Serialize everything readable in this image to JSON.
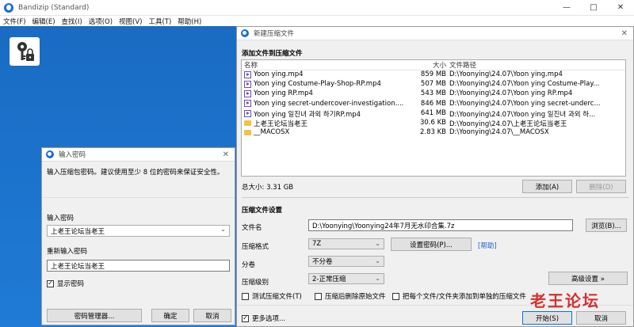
{
  "window": {
    "title": "Bandizip (Standard)",
    "controls": {
      "minimize": "—",
      "maximize": "□",
      "close": "✕"
    }
  },
  "menu": [
    "文件(F)",
    "编辑(E)",
    "查找(I)",
    "选项(O)",
    "视图(V)",
    "工具(T)",
    "帮助(H)"
  ],
  "password_dialog": {
    "title": "输入密码",
    "close": "✕",
    "description": "输入压缩包密码。建议使用至少 8 位的密码来保证安全性。",
    "password_label": "输入密码",
    "password_value": "上老王论坛当老王",
    "confirm_label": "重新输入密码",
    "confirm_value": "上老王论坛当老王",
    "show_password": "显示密码",
    "show_password_checked": true,
    "manager_button": "密码管理器...",
    "ok_button": "确定",
    "cancel_button": "取消"
  },
  "new_archive_dialog": {
    "title": "新建压缩文件",
    "close": "✕",
    "section_add": "添加文件到压缩文件",
    "columns": {
      "name": "名称",
      "size": "大小",
      "path": "文件路径"
    },
    "files": [
      {
        "name": "Yoon ying.mp4",
        "size": "859 MB",
        "path": "D:\\Yoonying\\24.07\\Yoon ying.mp4",
        "icon": "video-file-icon"
      },
      {
        "name": "Yoon ying Costume-Play-Shop-RP.mp4",
        "size": "507 MB",
        "path": "D:\\Yoonying\\24.07\\Yoon ying Costume-Play...",
        "icon": "video-file-icon"
      },
      {
        "name": "Yoon ying RP.mp4",
        "size": "543 MB",
        "path": "D:\\Yoonying\\24.07\\Yoon ying RP.mp4",
        "icon": "video-file-icon"
      },
      {
        "name": "Yoon ying secret-undercover-investigation....",
        "size": "846 MB",
        "path": "D:\\Yoonying\\24.07\\Yoon ying secret-underc...",
        "icon": "video-file-icon"
      },
      {
        "name": "Yoon ying 일진녀 과외 하기RP.mp4",
        "size": "641 MB",
        "path": "D:\\Yoonying\\24.07\\Yoon ying 일진녀 과외 하...",
        "icon": "video-file-icon"
      },
      {
        "name": "上老王论坛当老王",
        "size": "30.6 KB",
        "path": "D:\\Yoonying\\24.07\\上老王论坛当老王",
        "icon": "folder-icon"
      },
      {
        "name": "__MACOSX",
        "size": "2.83 KB",
        "path": "D:\\Yoonying\\24.07\\__MACOSX",
        "icon": "folder-icon"
      }
    ],
    "total_size": "总大小: 3.31 GB",
    "add_button": "添加(A)",
    "delete_button": "删除(D)",
    "section_settings": "压缩文件设置",
    "filename_label": "文件名",
    "filename_value": "D:\\Yoonying\\Yoonying24年7月无水印合集.7z",
    "browse_button": "浏览(B)...",
    "format_label": "压缩格式",
    "format_value": "7Z",
    "set_password_button": "设置密码(P)...",
    "help_link": "[帮助]",
    "split_label": "分卷",
    "split_value": "不分卷",
    "level_label": "压缩级别",
    "level_value": "2-正常压缩",
    "advanced_button": "高级设置 »",
    "test_checkbox": "测试压缩文件(T)",
    "delete_after_checkbox": "压缩后删除原始文件",
    "separate_checkbox": "把每个文件/文件夹添加到单独的压缩文件",
    "more_options": "更多选项...",
    "more_options_checked": true,
    "start_button": "开始(S)",
    "cancel_button": "取消"
  },
  "watermark": "老王论坛",
  "icons": {
    "app": "bandizip-logo-icon",
    "key": "key-lock-icon"
  }
}
